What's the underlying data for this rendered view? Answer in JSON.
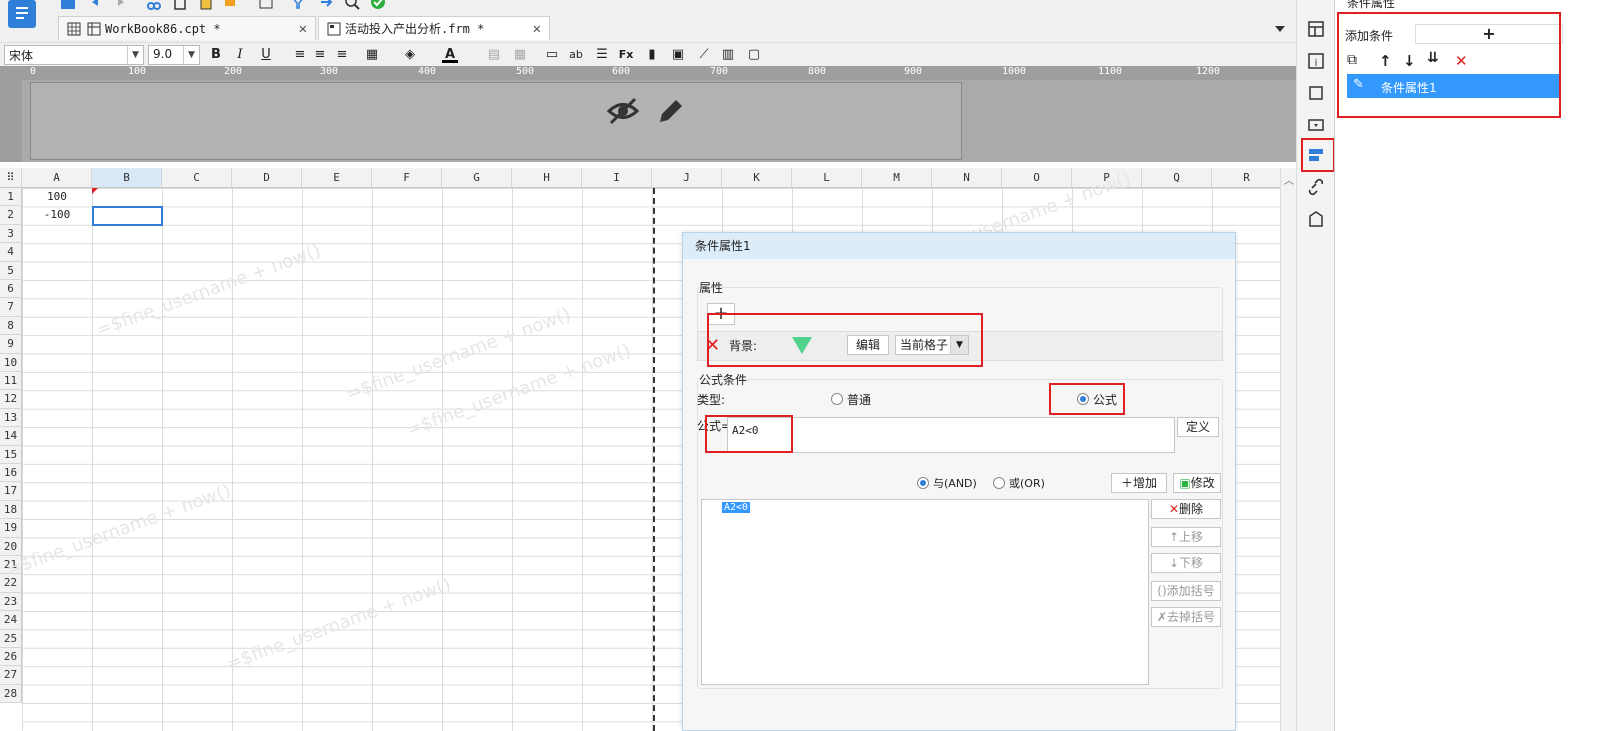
{
  "tabs": [
    {
      "label": "WorkBook86.cpt *"
    },
    {
      "label": "活动投入产出分析.frm *"
    }
  ],
  "format": {
    "font_name": "宋体",
    "font_size": "9.0"
  },
  "ruler": {
    "ticks": [
      "0",
      "100",
      "200",
      "300",
      "400",
      "500",
      "600",
      "700",
      "800",
      "900",
      "1000",
      "1100",
      "1200"
    ]
  },
  "grid": {
    "columns": [
      "A",
      "B",
      "C",
      "D",
      "E",
      "F",
      "G",
      "H",
      "I",
      "J",
      "K",
      "L",
      "M",
      "N",
      "O",
      "P",
      "Q",
      "R"
    ],
    "rows": [
      "1",
      "2",
      "3",
      "4",
      "5",
      "6",
      "7",
      "8",
      "9",
      "10",
      "11",
      "12",
      "13",
      "14",
      "15",
      "16",
      "17",
      "18",
      "19",
      "20",
      "21",
      "22",
      "23",
      "24",
      "25",
      "26",
      "27",
      "28"
    ],
    "cells": {
      "A1": "100",
      "A2": "-100"
    },
    "watermark": "=$fine_username + now()"
  },
  "dialog": {
    "title": "条件属性1",
    "attr_section": "属性",
    "add_symbol": "+",
    "background_label": "背景:",
    "edit_btn": "编辑",
    "scope_value": "当前格子",
    "formula_section": "公式条件",
    "type_label": "类型:",
    "radio_normal": "普通",
    "radio_formula": "公式",
    "formula_label": "公式=",
    "formula_value": "A2<0",
    "define_btn": "定义",
    "and_label": "与(AND)",
    "or_label": "或(OR)",
    "add_btn": "增加",
    "modify_btn": "修改",
    "condition_item": "A2<0",
    "delete_btn": "删除",
    "up_btn": "上移",
    "down_btn": "下移",
    "add_paren_btn": "添加括号",
    "remove_paren_btn": "去掉括号"
  },
  "panel": {
    "title": "条件属性",
    "add_condition_label": "添加条件",
    "add_symbol": "+",
    "list_item": "条件属性1"
  },
  "colors": {
    "accent": "#2f7fd8",
    "highlight_red": "#e02020",
    "selected_row": "#3399ff"
  }
}
